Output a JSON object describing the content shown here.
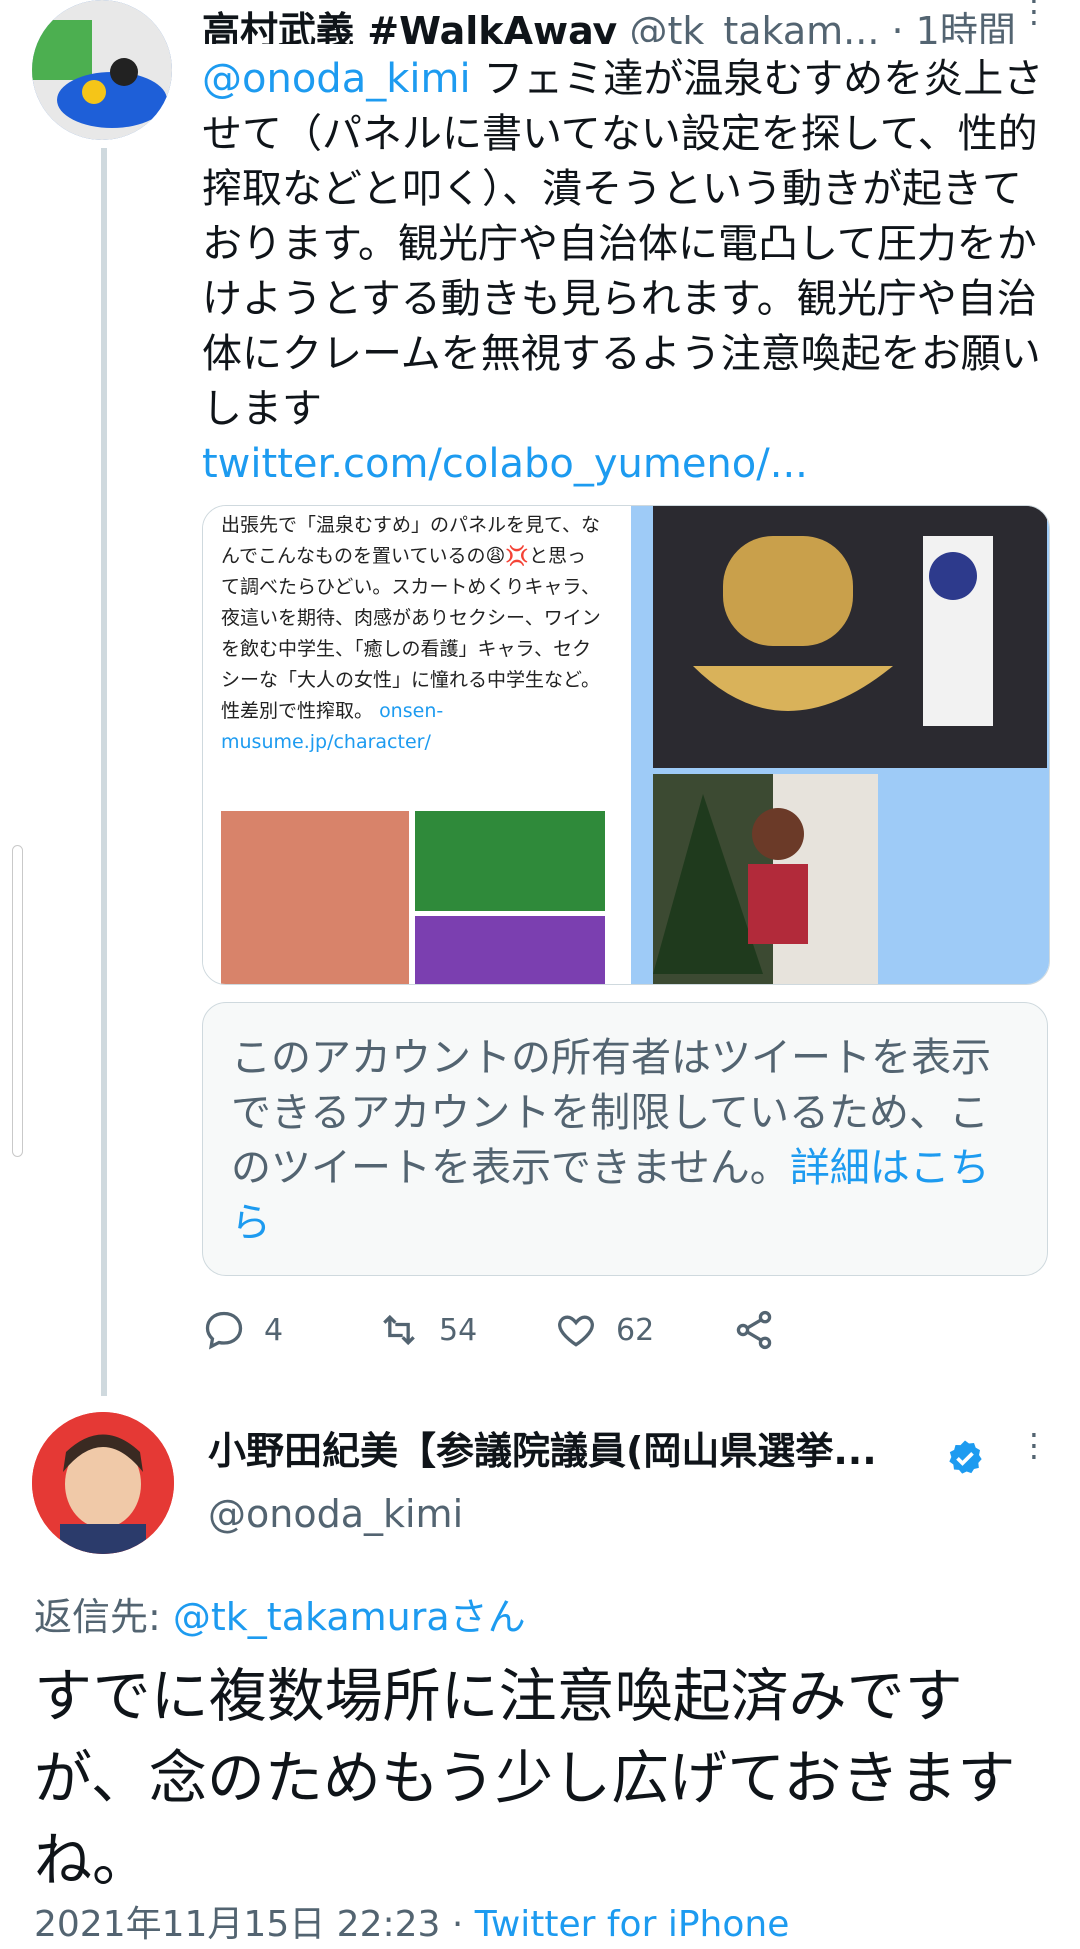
{
  "tweet1": {
    "display_name": "高村武義 #WalkAway",
    "handle": "@tk_takam...",
    "time": "1時間",
    "mention": "@onoda_kimi",
    "text": " フェミ達が温泉むすめを炎上させて（パネルに書いてない設定を探して、性的搾取などと叩く）、潰そうという動きが起きております。観光庁や自治体に電凸して圧力をかけようとする動きも見られます。観光庁や自治体にクレームを無視するよう注意喚起をお願いします",
    "link": "twitter.com/colabo_yumeno/...",
    "media_left_text": "出張先で「温泉むすめ」のパネルを見て、なんでこんなものを置いているの😩💢と思って調べたらひどい。スカートめくりキャラ、夜這いを期待、肉感がありセクシー、ワインを飲む中学生、「癒しの看護」キャラ、セクシーな「大人の女性」に憧れる中学生など。性差別で性搾取。",
    "media_left_link": "onsen-musume.jp/character/",
    "quote_text": "このアカウントの所有者はツイートを表示できるアカウントを制限しているため、このツイートを表示できません。",
    "quote_link": "詳細はこちら",
    "replies": "4",
    "retweets": "54",
    "likes": "62"
  },
  "tweet2": {
    "display_name": "小野田紀美【参議院議員(岡山県選挙...",
    "handle": "@onoda_kimi",
    "reply_prefix": "返信先: ",
    "reply_to": "@tk_takamuraさん",
    "text": "すでに複数場所に注意喚起済みですが、念のためもう少し広げておきますね。",
    "date": "2021年11月15日 22:23",
    "separator": " · ",
    "source": "Twitter for iPhone"
  },
  "colors": {
    "accent": "#1d9bf0",
    "secondary_text": "#536471",
    "border": "#cfd9de"
  }
}
